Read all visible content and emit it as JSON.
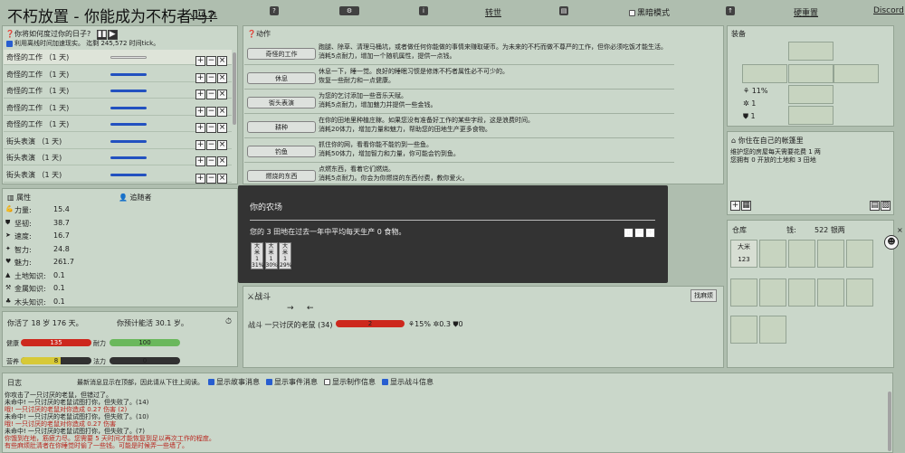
{
  "title": "不朽放置 - 你能成为不朽者吗?",
  "version": "v1.0.21",
  "top": {
    "rebirth": "转世",
    "dark_mode": "黑暗模式",
    "hard_reset": "硬重置",
    "discord": "Discord"
  },
  "day": {
    "heading": "你将如何度过你的日子?",
    "offline": "利用离线时间加速现实。 迄剩 245,572 时间tick。"
  },
  "tasks": [
    {
      "label": "奇怪的工作 （1 天)"
    },
    {
      "label": "奇怪的工作 （1 天)"
    },
    {
      "label": "奇怪的工作 （1 天)"
    },
    {
      "label": "奇怪的工作 （1 天)"
    },
    {
      "label": "奇怪的工作 （1 天)"
    },
    {
      "label": "街头表演 （1 天)"
    },
    {
      "label": "街头表演 （1 天)"
    },
    {
      "label": "街头表演 （1 天)"
    }
  ],
  "actions": {
    "heading": "动作",
    "items": [
      {
        "btn": "奇怪的工作",
        "l1": "跑腿、除草、清理马桶坑，或者做任何你能做的事情来赚取硬币。为未来的不朽而做不尊严的工作，但你必须吃饭才能生活。",
        "l2": "消耗5点耐力，增加一个随机属性，提供一点钱。"
      },
      {
        "btn": "休息",
        "l1": "休息一下，睡一觉。良好的睡眠习惯是修炼不朽者属性必不可少的。",
        "l2": "恢复一些耐力和一点健康。"
      },
      {
        "btn": "街头表演",
        "l1": "为您的乞讨添加一些音乐天赋。",
        "l2": "消耗5点耐力，增加魅力并提供一些金钱。"
      },
      {
        "btn": "耕种",
        "l1": "在你的田地里种植庄稼。如果您没有准备好工作的某些字段，这是浪费时间。",
        "l2": "消耗20体力，增加力量和魅力，帮助您的田地生产更多食物。"
      },
      {
        "btn": "钓鱼",
        "l1": "抓住你的网，看看你能不能钓到一些鱼。",
        "l2": "消耗50体力，增加智力和力量，你可能会钓到鱼。"
      },
      {
        "btn": "燃烧的东西",
        "l1": "点燃东西，看着它们燃烧。",
        "l2": "消耗5点耐力。你会为你燃烧的东西付费，教你爱火。"
      }
    ]
  },
  "attrs": {
    "tab1": "属性",
    "tab2": "追随者",
    "items": [
      {
        "icon": "muscle-icon",
        "label": "力量:",
        "value": "15.4"
      },
      {
        "icon": "shield-icon",
        "label": "坚韧:",
        "value": "38.7"
      },
      {
        "icon": "speed-icon",
        "label": "速度:",
        "value": "16.7"
      },
      {
        "icon": "brain-icon",
        "label": "智力:",
        "value": "24.8"
      },
      {
        "icon": "charm-icon",
        "label": "魅力:",
        "value": "261.7"
      },
      {
        "icon": "land-icon",
        "label": "土地知识:",
        "value": "0.1"
      },
      {
        "icon": "metal-icon",
        "label": "金属知识:",
        "value": "0.1"
      },
      {
        "icon": "wood-icon",
        "label": "木头知识:",
        "value": "0.1"
      }
    ]
  },
  "life": {
    "age": "你活了 18 岁 176 天。",
    "expect": "你预计能活 30.1 岁。",
    "health_label": "健康",
    "health_val": "135",
    "stamina_label": "耐力",
    "stamina_val": "100",
    "nutrition_label": "营养",
    "nutrition_val": "8",
    "mana_label": "法力",
    "mana_val": "0"
  },
  "combat": {
    "heading": "战斗",
    "flee": "找麻烦",
    "enemy": "战斗 一只讨厌的老鼠 (34)",
    "enemy_hp": "2",
    "pct": "15%",
    "atk": "0.3",
    "def": "0"
  },
  "equip": {
    "heading": "装备",
    "pct": "11%",
    "a": "1",
    "b": "1"
  },
  "home": {
    "heading": "你住在自己的帐篷里",
    "l1": "维护您的房屋每天需要花费 1 两",
    "l2": "您拥有 0 开放的土地和 3 田地"
  },
  "warehouse": {
    "heading": "仓库",
    "money_label": "钱:",
    "money": "522 银两",
    "item_name": "大米",
    "item_count": "123"
  },
  "log": {
    "heading": "日志",
    "note": "最新消息显示在顶部，因此请从下往上阅读。",
    "f1": "显示故事消息",
    "f2": "显示事件消息",
    "f3": "显示制作信息",
    "f4": "显示战斗信息",
    "lines": [
      {
        "t": "你攻击了一只讨厌的老鼠，但错过了。",
        "c": "#222"
      },
      {
        "t": "未命中! 一只讨厌的老鼠试图打你，但失败了。(14)",
        "c": "#222"
      },
      {
        "t": "哦! 一只讨厌的老鼠对你造成 0.27 伤害 (2)",
        "c": "#c0271f"
      },
      {
        "t": "未命中! 一只讨厌的老鼠试图打你，但失败了。(10)",
        "c": "#222"
      },
      {
        "t": "哦! 一只讨厌的老鼠对你造成 0.27 伤害",
        "c": "#c0271f"
      },
      {
        "t": "未命中! 一只讨厌的老鼠试图打你，但失败了。(7)",
        "c": "#222"
      },
      {
        "t": "你饿到在地，筋疲力尽。您需要 5 天时间才能恢复到足以再次工作的程度。",
        "c": "#c0271f"
      },
      {
        "t": "有些麻烦肚清者在你睡觉时偷了一些钱。可能是时候弄一些墙了。",
        "c": "#c0271f"
      }
    ]
  },
  "modal": {
    "title": "你的农场",
    "text": "您的 3 田地在过去一年中平均每天生产 0 食物。",
    "cards": [
      {
        "l1": "大",
        "l2": "米",
        "n": "1",
        "p": "31%"
      },
      {
        "l1": "大",
        "l2": "米",
        "n": "1",
        "p": "30%"
      },
      {
        "l1": "大",
        "l2": "米",
        "n": "1",
        "p": "29%"
      }
    ]
  }
}
